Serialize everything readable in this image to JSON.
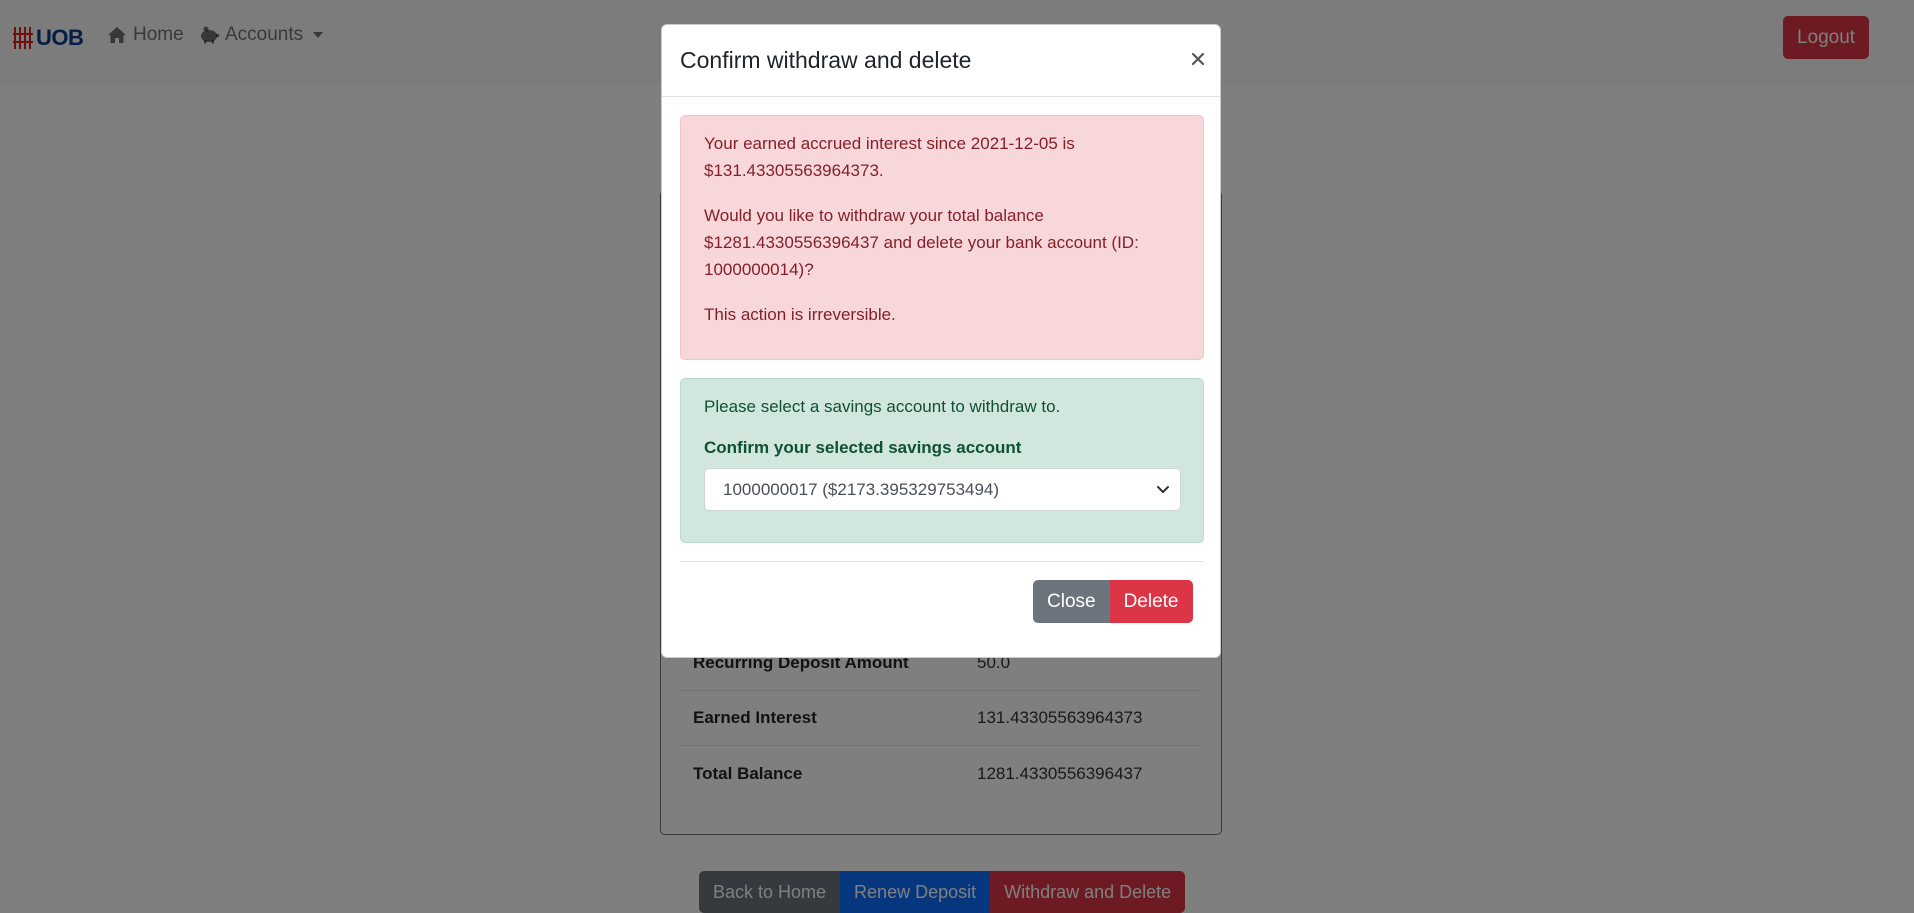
{
  "navbar": {
    "brand": "UOB",
    "home_label": "Home",
    "accounts_label": "Accounts",
    "logout_label": "Logout"
  },
  "details": {
    "recurring_label": "Recurring Deposit Amount",
    "recurring_value": "50.0",
    "interest_label": "Earned Interest",
    "interest_value": "131.43305563964373",
    "balance_label": "Total Balance",
    "balance_value": "1281.4330556396437"
  },
  "actions": {
    "back_label": "Back to Home",
    "renew_label": "Renew Deposit",
    "withdraw_label": "Withdraw and Delete"
  },
  "modal": {
    "title": "Confirm withdraw and delete",
    "danger_p1": "Your earned accrued interest since 2021-12-05 is $131.43305563964373.",
    "danger_p2": "Would you like to withdraw your total balance $1281.4330556396437 and delete your bank account (ID: 1000000014)?",
    "danger_p3": "This action is irreversible.",
    "success_text": "Please select a savings account to withdraw to.",
    "select_label": "Confirm your selected savings account",
    "selected_account": "1000000017 ($2173.395329753494)",
    "close_label": "Close",
    "delete_label": "Delete"
  },
  "colors": {
    "danger": "#dc3545",
    "primary": "#0d6efd",
    "secondary": "#6c757d",
    "brand_blue": "#0b3c8c",
    "brand_red": "#e0201a"
  },
  "icons": [
    "home-icon",
    "piggy-bank-icon",
    "caret-down-icon",
    "close-icon",
    "chevron-down-icon"
  ]
}
